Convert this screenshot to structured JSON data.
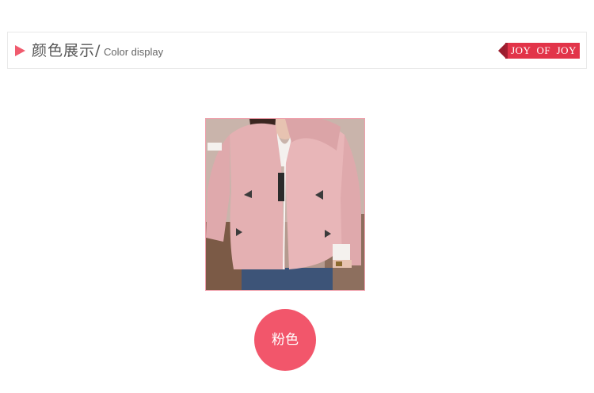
{
  "section": {
    "title_cn": "颜色展示/",
    "title_en": "Color display",
    "play_icon": "play-triangle-icon",
    "accent_color": "#f05b6e"
  },
  "brand": {
    "label": "JOY  OF  JOY",
    "color": "#e23449"
  },
  "product": {
    "image": "pink-hooded-jacket-photo"
  },
  "swatch": {
    "label": "粉色",
    "color": "#f2566b"
  }
}
